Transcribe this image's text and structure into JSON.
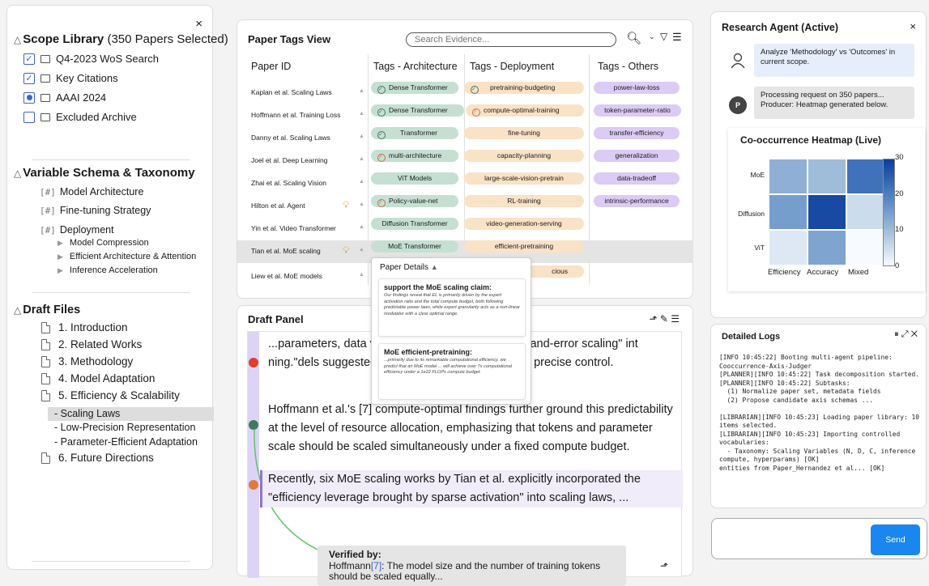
{
  "left_panel": {
    "close": "×",
    "scope": {
      "title": "Scope Library",
      "subtitle": "(350 Papers Selected)",
      "items": [
        {
          "label": "Q4-2023 WoS Search"
        },
        {
          "label": "Key Citations"
        },
        {
          "label": "AAAI 2024"
        },
        {
          "label": "Excluded Archive"
        }
      ]
    },
    "schema": {
      "title": "Variable Schema & Taxonomy",
      "items": [
        "Model Architecture",
        "Fine-tuning Strategy",
        "Deployment"
      ],
      "hash": "[#]",
      "sub_items": [
        "Model Compression",
        "Efficient Architecture & Attention",
        "Inference Acceleration"
      ]
    },
    "drafts": {
      "title": "Draft Files",
      "files": [
        "1. Introduction",
        "2. Related Works",
        "3. Methodology",
        "4. Model Adaptation",
        "5. Efficiency & Scalability"
      ],
      "sub_files": [
        "- Scaling Laws",
        "- Low-Precision Representation",
        "- Parameter-Efficient Adaptation"
      ],
      "last_file": "6. Future Directions"
    }
  },
  "tags_view": {
    "title": "Paper Tags View",
    "search_placeholder": "Search Evidence...",
    "headers": [
      "Paper ID",
      "Tags - Architecture",
      "Tags - Deployment",
      "Tags - Others"
    ],
    "rows": [
      {
        "id": "Kaplan et al.  Scaling Laws",
        "arch": "Dense Transformer",
        "dep": "pretraining-budgeting",
        "other": "power-law-loss"
      },
      {
        "id": "Hoffmann et al. Training Loss",
        "arch": "Dense Transformer",
        "dep": "compute-optimal-training",
        "other": "token-parameter-ratio"
      },
      {
        "id": "Danny et al. Scaling Laws",
        "arch": "Transformer",
        "dep": "fine-tuning",
        "other": "transfer-efficiency"
      },
      {
        "id": "Joel et al.  Deep Learning",
        "arch": "multi-architecture",
        "dep": "capacity-planning",
        "other": "generalization"
      },
      {
        "id": "Zhai et al. Scaling Vision",
        "arch": "ViT Models",
        "dep": "large-scale-vision-pretrain",
        "other": "data-tradeoff"
      },
      {
        "id": "Hilton et al. Agent",
        "arch": "Policy-value-net",
        "dep": "RL-training",
        "other": "intrinsic-performance"
      },
      {
        "id": "Yin et al. Video Transformer",
        "arch": "Diffusion Transformer",
        "dep": "video-generation-serving",
        "other": ""
      },
      {
        "id": "Tian et al. MoE scaling",
        "arch": "MoE Transformer",
        "dep": "efficient-pretraining",
        "other": ""
      },
      {
        "id": "Liew et al. MoE models",
        "arch": "",
        "dep": "cious",
        "other": ""
      }
    ]
  },
  "paper_details": {
    "title": "Paper Details",
    "cards": [
      {
        "title": "support the MoE scaling claim:",
        "body": "Our findings reveal that EL is primarily driven by the expert activation ratio and the total compute budget, both following predictable power laws, while expert granularity acts as a non-linear modulator with a clear optimal range."
      },
      {
        "title": "MoE efficient-pretraining:",
        "body": "...primarily due to its remarkable computational efficiency. we predict that an MoE model ... will achieve over 7x computational efficiency under a 1e22 FLOPs compute budget."
      }
    ]
  },
  "draft_panel": {
    "title": "Draft Panel",
    "p1": "...parameters, data vo                         , thereby transforming \"trial-and-error scaling\" int                        ning.\"dels suggested correlation only. How                        wed for precise control.",
    "p2": "Hoffmann et al.'s [7] compute-optimal findings further ground this predictability at the level of resource allocation, emphasizing that tokens and parameter scale should be scaled simultaneously under a fixed compute budget.",
    "p3": "Recently, six MoE scaling works by Tian et al. explicitly incorporated the \"efficiency leverage brought by sparse activation\" into scaling laws, ...",
    "verified": {
      "title": "Verified by:",
      "author": "Hoffmann",
      "cite": "[7]",
      "text": ": The model size and the number of training tokens should be scaled equally..."
    }
  },
  "agent": {
    "title": "Research Agent (Active)",
    "close": "×",
    "user_msg": "Analyze 'Methodology' vs 'Outcomes' in current scope.",
    "avatar": "P",
    "bot_msg": "Processing request on 350 papers... Producer: Heatmap generated below."
  },
  "chart_data": {
    "type": "heatmap",
    "title": "Co-occurrence Heatmap (Live)",
    "rows": [
      "MoE",
      "Diffusion",
      "ViT"
    ],
    "columns": [
      "Efficiency",
      "Accuracy",
      "Mixed"
    ],
    "values": [
      [
        12,
        10,
        22
      ],
      [
        15,
        28,
        5
      ],
      [
        3,
        14,
        0
      ]
    ],
    "colorbar_range": [
      0,
      30
    ],
    "colorbar_ticks": [
      "30",
      "20",
      "10",
      "0"
    ]
  },
  "logs": {
    "title": "Detailed Logs",
    "text": "[INFO 10:45:22] Booting multi-agent pipeline: Cooccurrence-Axis-Judger\n[PLANNER][INFO 10:45:22] Task decomposition started.\n[PLANNER][INFO 10:45:22] Subtasks:\n  (1) Normalize paper set, metadata fields\n  (2) Propose candidate axis schemas ...\n\n[LIBRARIAN][INFO 10:45:23] Loading paper library: 10 items selected.\n[LIBRARIAN][INFO 10:45:23] Importing controlled vocabularies:\n  - Taxonomy: Scaling Variables (N, D, C, inference compute, hyperparams) [OK]\nentities from Paper_Hernandez et al... [OK]"
  },
  "chat": {
    "placeholder": "",
    "send": "Send"
  }
}
